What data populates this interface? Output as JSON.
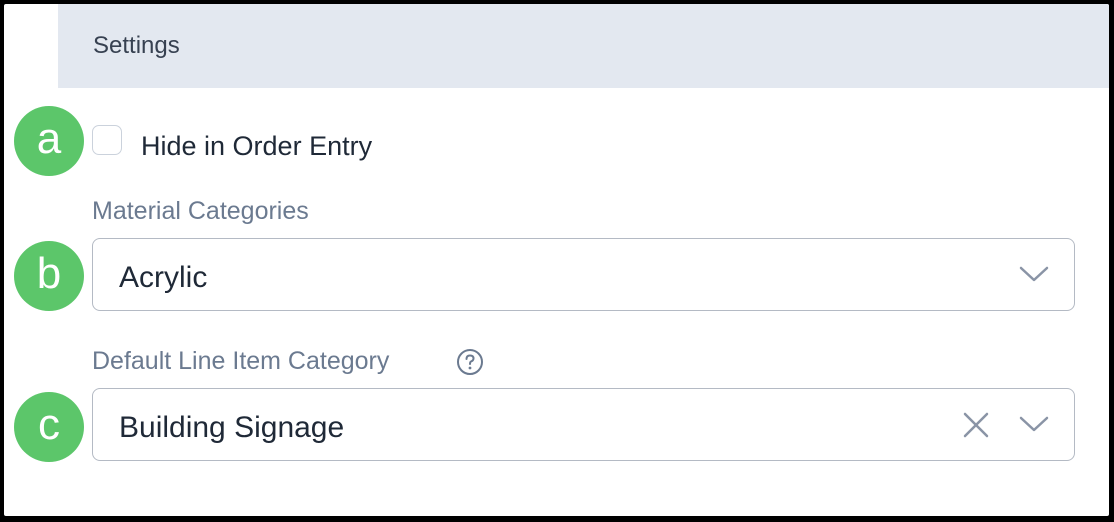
{
  "header": {
    "title": "Settings"
  },
  "markers": {
    "a": "a",
    "b": "b",
    "c": "c"
  },
  "hide_in_order_entry": {
    "label": "Hide in Order Entry",
    "checked": false
  },
  "material_categories": {
    "label": "Material Categories",
    "value": "Acrylic",
    "icon": "chevron-down-icon"
  },
  "default_line_item_category": {
    "label": "Default Line Item Category",
    "value": "Building Signage",
    "help_icon": "question-circle-icon",
    "clear_icon": "close-icon",
    "chevron_icon": "chevron-down-icon"
  },
  "colors": {
    "header_bg": "#e3e8f0",
    "marker": "#5cc66a",
    "label": "#6b7a90"
  }
}
